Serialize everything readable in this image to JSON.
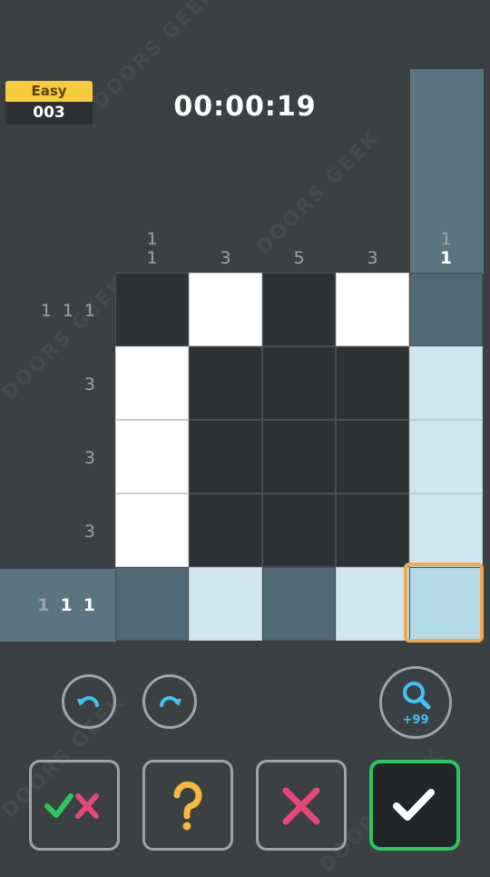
{
  "level": {
    "difficulty": "Easy",
    "number": "003"
  },
  "timer": "00:00:19",
  "column_clues": [
    [
      "1",
      "1"
    ],
    [
      "3"
    ],
    [
      "5"
    ],
    [
      "3"
    ],
    [
      "1",
      "1"
    ]
  ],
  "row_clues": [
    [
      "1",
      "1",
      "1"
    ],
    [
      "3"
    ],
    [
      "3"
    ],
    [
      "3"
    ],
    [
      "1",
      "1",
      "1"
    ]
  ],
  "active_column": 4,
  "active_row": 4,
  "grid": [
    [
      "dark",
      "white",
      "dark",
      "white",
      "hl-dark"
    ],
    [
      "white",
      "dark",
      "dark",
      "dark",
      "hl-empty"
    ],
    [
      "white",
      "dark",
      "dark",
      "dark",
      "hl-empty"
    ],
    [
      "white",
      "dark",
      "dark",
      "dark",
      "hl-empty"
    ],
    [
      "hl-dark",
      "hl-empty",
      "hl-dark",
      "hl-empty",
      "sel"
    ]
  ],
  "zoom": {
    "count": "+99"
  },
  "colors": {
    "accent_blue": "#3fc3f5",
    "check_green": "#2bc65e",
    "cross_pink": "#e8467a",
    "hint_yellow": "#f6b93b",
    "cursor_orange": "#f2a950"
  }
}
